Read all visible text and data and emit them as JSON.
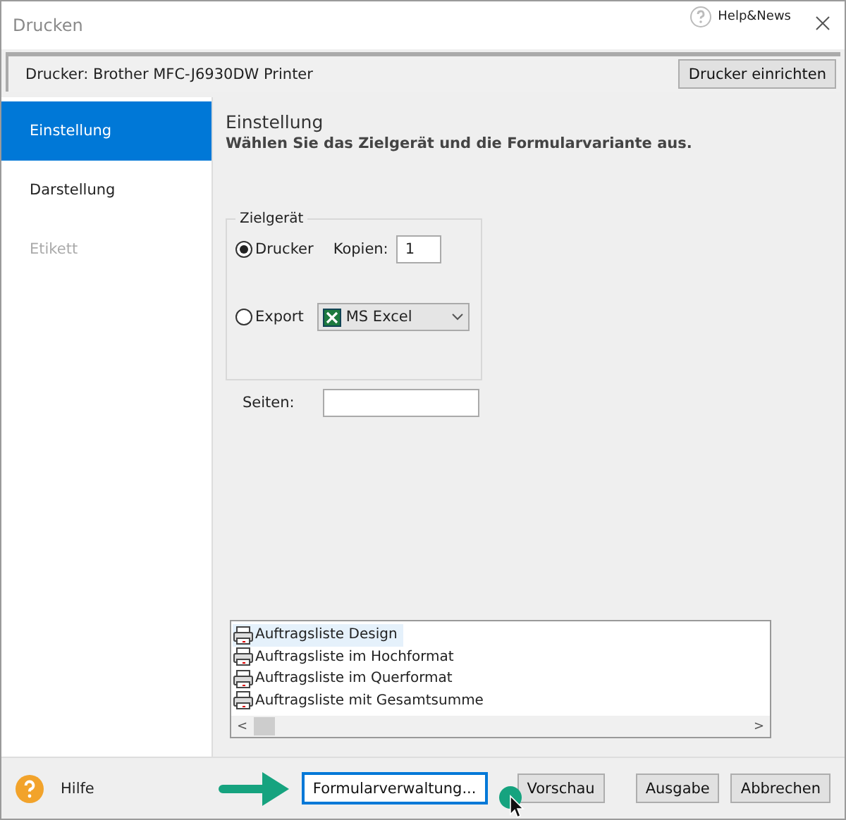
{
  "window": {
    "title": "Drucken",
    "help_news": "Help&News"
  },
  "printer_bar": {
    "label": "Drucker: Brother MFC-J6930DW Printer",
    "button": "Drucker einrichten"
  },
  "sidebar": {
    "items": [
      {
        "label": "Einstellung",
        "selected": true,
        "disabled": false
      },
      {
        "label": "Darstellung",
        "selected": false,
        "disabled": false
      },
      {
        "label": "Etikett",
        "selected": false,
        "disabled": true
      }
    ]
  },
  "content": {
    "heading": "Einstellung",
    "subtitle": "Wählen Sie das Zielgerät und die Formularvariante aus.",
    "target_group": {
      "legend": "Zielgerät",
      "options": [
        {
          "label": "Drucker",
          "selected": true
        },
        {
          "label": "Export",
          "selected": false
        }
      ],
      "copies_label": "Kopien:",
      "copies_value": "1",
      "export_format": "MS Excel"
    },
    "pages_label": "Seiten:",
    "forms": [
      {
        "label": "Auftragsliste Design",
        "selected": true
      },
      {
        "label": "Auftragsliste im Hochformat",
        "selected": false
      },
      {
        "label": "Auftragsliste im Querformat",
        "selected": false
      },
      {
        "label": "Auftragsliste mit Gesamtsumme",
        "selected": false
      }
    ],
    "scroll_left": "<",
    "scroll_right": ">"
  },
  "footer": {
    "help": "Hilfe",
    "buttons": [
      {
        "label": "Formularverwaltung...",
        "focused": true
      },
      {
        "label": "Vorschau",
        "focused": false
      },
      {
        "label": "Ausgabe",
        "focused": false
      },
      {
        "label": "Abbrechen",
        "focused": false
      }
    ]
  }
}
